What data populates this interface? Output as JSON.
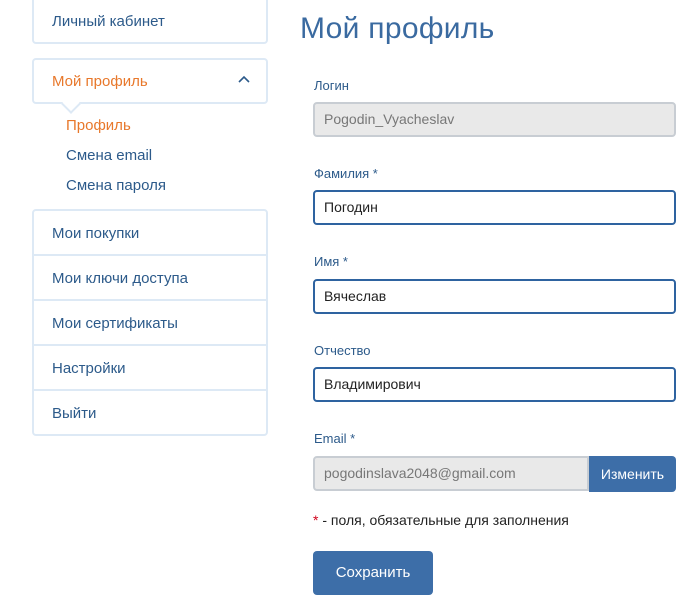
{
  "sidebar": {
    "top_item": "Личный кабинет",
    "profile_item": "Мой профиль",
    "sub_items": [
      "Профиль",
      "Смена email",
      "Смена пароля"
    ],
    "items": [
      "Мои покупки",
      "Мои ключи доступа",
      "Мои сертификаты",
      "Настройки",
      "Выйти"
    ]
  },
  "main": {
    "title": "Мой профиль",
    "login": {
      "label": "Логин",
      "value": "Pogodin_Vyacheslav"
    },
    "last_name": {
      "label": "Фамилия *",
      "value": "Погодин"
    },
    "first_name": {
      "label": "Имя *",
      "value": "Вячеслав"
    },
    "middle_name": {
      "label": "Отчество",
      "value": "Владимирович"
    },
    "email": {
      "label": "Email *",
      "value": "pogodinslava2048@gmail.com",
      "change_label": "Изменить"
    },
    "required_note_star": "*",
    "required_note": " - поля, обязательные для заполнения",
    "save_label": "Сохранить"
  },
  "colors": {
    "accent": "#3d6ea8",
    "active": "#e8782b",
    "text": "#2c5a8a"
  }
}
